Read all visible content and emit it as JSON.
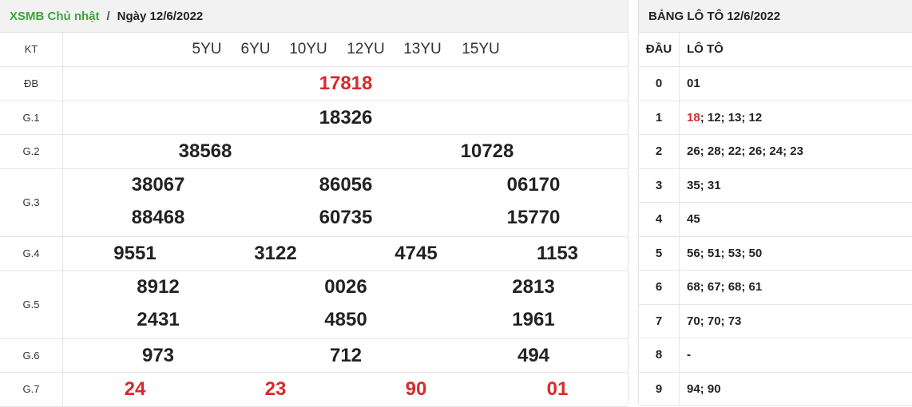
{
  "results": {
    "link": "XSMB Chủ nhật",
    "sep": "/",
    "date": "Ngày 12/6/2022",
    "rows": [
      {
        "label": "KT",
        "nums": [
          "5YU",
          "6YU",
          "10YU",
          "12YU",
          "13YU",
          "15YU"
        ]
      },
      {
        "label": "ĐB",
        "nums": [
          "17818"
        ]
      },
      {
        "label": "G.1",
        "nums": [
          "18326"
        ]
      },
      {
        "label": "G.2",
        "nums": [
          "38568",
          "10728"
        ]
      },
      {
        "label": "G.3",
        "nums": [
          "38067",
          "86056",
          "06170",
          "88468",
          "60735",
          "15770"
        ]
      },
      {
        "label": "G.4",
        "nums": [
          "9551",
          "3122",
          "4745",
          "1153"
        ]
      },
      {
        "label": "G.5",
        "nums": [
          "8912",
          "0026",
          "2813",
          "2431",
          "4850",
          "1961"
        ]
      },
      {
        "label": "G.6",
        "nums": [
          "973",
          "712",
          "494"
        ]
      },
      {
        "label": "G.7",
        "nums": [
          "24",
          "23",
          "90",
          "01"
        ]
      }
    ]
  },
  "loto": {
    "title": "BẢNG LÔ TÔ 12/6/2022",
    "col_dau": "ĐẦU",
    "col_loto": "LÔ TÔ",
    "rows": [
      {
        "dau": "0",
        "hl": "",
        "rest": "01"
      },
      {
        "dau": "1",
        "hl": "18",
        "rest": "; 12; 13; 12"
      },
      {
        "dau": "2",
        "hl": "",
        "rest": "26; 28; 22; 26; 24; 23"
      },
      {
        "dau": "3",
        "hl": "",
        "rest": "35; 31"
      },
      {
        "dau": "4",
        "hl": "",
        "rest": "45"
      },
      {
        "dau": "5",
        "hl": "",
        "rest": "56; 51; 53; 50"
      },
      {
        "dau": "6",
        "hl": "",
        "rest": "68; 67; 68; 61"
      },
      {
        "dau": "7",
        "hl": "",
        "rest": "70; 70; 73"
      },
      {
        "dau": "8",
        "hl": "",
        "rest": "-"
      },
      {
        "dau": "9",
        "hl": "",
        "rest": "94; 90"
      }
    ]
  },
  "colors": {
    "green": "#3aa63a",
    "red": "#d9292b"
  }
}
